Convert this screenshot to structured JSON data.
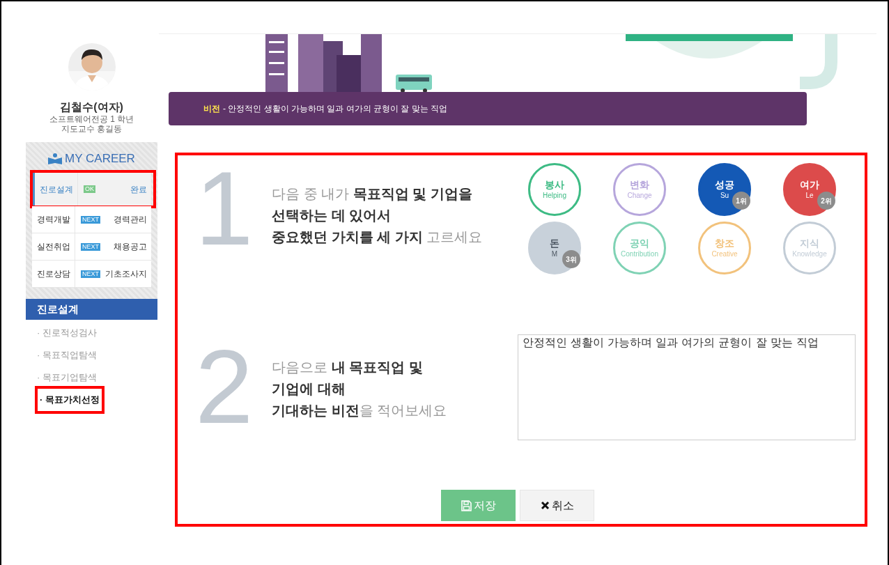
{
  "profile": {
    "name": "김철수(여자)",
    "lines": [
      "소프트웨어전공 1 학년",
      "지도교수 홍길동"
    ]
  },
  "career": {
    "title": "MY CAREER",
    "rows": [
      {
        "left": "진로설계",
        "tag": "OK",
        "color": "#7cc98a",
        "right": "완료",
        "selected": true,
        "highlighted": true
      },
      {
        "left": "경력개발",
        "tag": "NEXT",
        "color": "#3a9ad9",
        "right": "경력관리",
        "selected": false,
        "highlighted": false
      },
      {
        "left": "실전취업",
        "tag": "NEXT",
        "color": "#3a9ad9",
        "right": "채용공고",
        "selected": false,
        "highlighted": false
      },
      {
        "left": "진로상담",
        "tag": "NEXT",
        "color": "#3a9ad9",
        "right": "기초조사지",
        "selected": false,
        "highlighted": false
      }
    ]
  },
  "section_menu": {
    "title": "진로설계",
    "items": [
      {
        "label": "· 진로적성검사",
        "selected": false,
        "highlighted": false
      },
      {
        "label": "· 목표직업탐색",
        "selected": false,
        "highlighted": false
      },
      {
        "label": "· 목표기업탐색",
        "selected": false,
        "highlighted": false
      },
      {
        "label": "· 목표가치선정",
        "selected": true,
        "highlighted": true
      }
    ]
  },
  "banner": {
    "label": "비전",
    "text": "- 안정적인 생활이 가능하며 일과 여가의 균형이 잘 맞는 직업"
  },
  "form": {
    "highlighted": true,
    "step1": {
      "number": "1",
      "question": "다음 중 내가 **목표직업 및 기업을**\n**선택하는 데 있어서**\n**중요했던 가치를 세 가지** 고르세요",
      "values": [
        {
          "ko": "봉사",
          "en": "Helping",
          "color": "#3dbb84",
          "selected": false
        },
        {
          "ko": "변화",
          "en": "Change",
          "color": "#b6a6dc",
          "selected": false
        },
        {
          "ko": "성공",
          "en": "Su",
          "color": "#1459b5",
          "selected": true,
          "rank": "1위"
        },
        {
          "ko": "여가",
          "en": "Le",
          "color": "#dc4b4b",
          "selected": true,
          "rank": "2위"
        },
        {
          "ko": "돈",
          "en": "M",
          "color": "#c8d1da",
          "selected": true,
          "rank": "3위"
        },
        {
          "ko": "공익",
          "en": "Contribution",
          "color": "#7fd2b4",
          "selected": false
        },
        {
          "ko": "창조",
          "en": "Creative",
          "color": "#f2c27c",
          "selected": false
        },
        {
          "ko": "지식",
          "en": "Knowledge",
          "color": "#c2ccd6",
          "selected": false
        }
      ]
    },
    "step2": {
      "number": "2",
      "question": "다음으로 **내 목표직업 및**\n**기업에 대해**\n**기대하는 비전**을 적어보세요",
      "answer": "안정적인 생활이 가능하며 일과 여가의 균형이 잘 맞는 직업"
    },
    "buttons": [
      {
        "kind": "save",
        "label": "저장"
      },
      {
        "kind": "cancel",
        "label": "취소"
      }
    ]
  }
}
